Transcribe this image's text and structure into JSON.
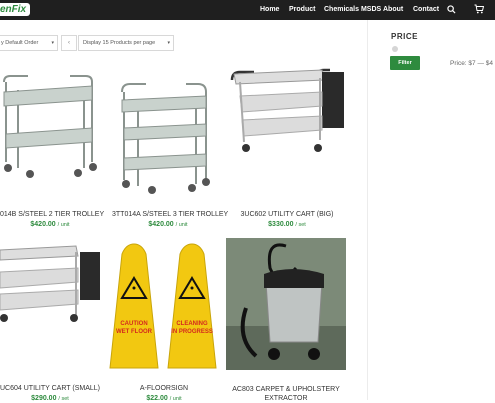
{
  "header": {
    "logo_text": "enFix",
    "nav": [
      "Home",
      "Product",
      "Chemicals MSDS",
      "About",
      "Contact"
    ],
    "icons": [
      "search-icon",
      "cart-icon"
    ]
  },
  "shop": {
    "sort_label": "y Default Order",
    "display_label": "Display 15 Products per page"
  },
  "sidebar": {
    "title": "PRICE",
    "filter_label": "Filter",
    "price_text": "Price: $7 — $4"
  },
  "products": [
    {
      "title": "014B S/STEEL 2 TIER TROLLEY",
      "price": "$420.00",
      "unit": "/ unit"
    },
    {
      "title": "3TT014A S/STEEL 3 TIER TROLLEY",
      "price": "$420.00",
      "unit": "/ unit"
    },
    {
      "title": "3UC602 UTILITY CART (BIG)",
      "price": "$330.00",
      "unit": "/ set"
    },
    {
      "title": "UC604 UTILITY CART (SMALL)",
      "price": "$290.00",
      "unit": "/ set"
    },
    {
      "title": "A-FLOORSIGN",
      "price": "$22.00",
      "unit": "/ unit"
    },
    {
      "title": "AC803 CARPET & UPHOLSTERY",
      "title2": "EXTRACTOR",
      "price": "",
      "unit": ""
    }
  ],
  "signs": {
    "left_line1": "CAUTION",
    "left_line2": "WET FLOOR",
    "right_line1": "CLEANING",
    "right_line2": "IN PROGRESS"
  },
  "colors": {
    "brand": "#2e8b3e",
    "topbar": "#1f1f1f",
    "sign": "#f2c811"
  }
}
